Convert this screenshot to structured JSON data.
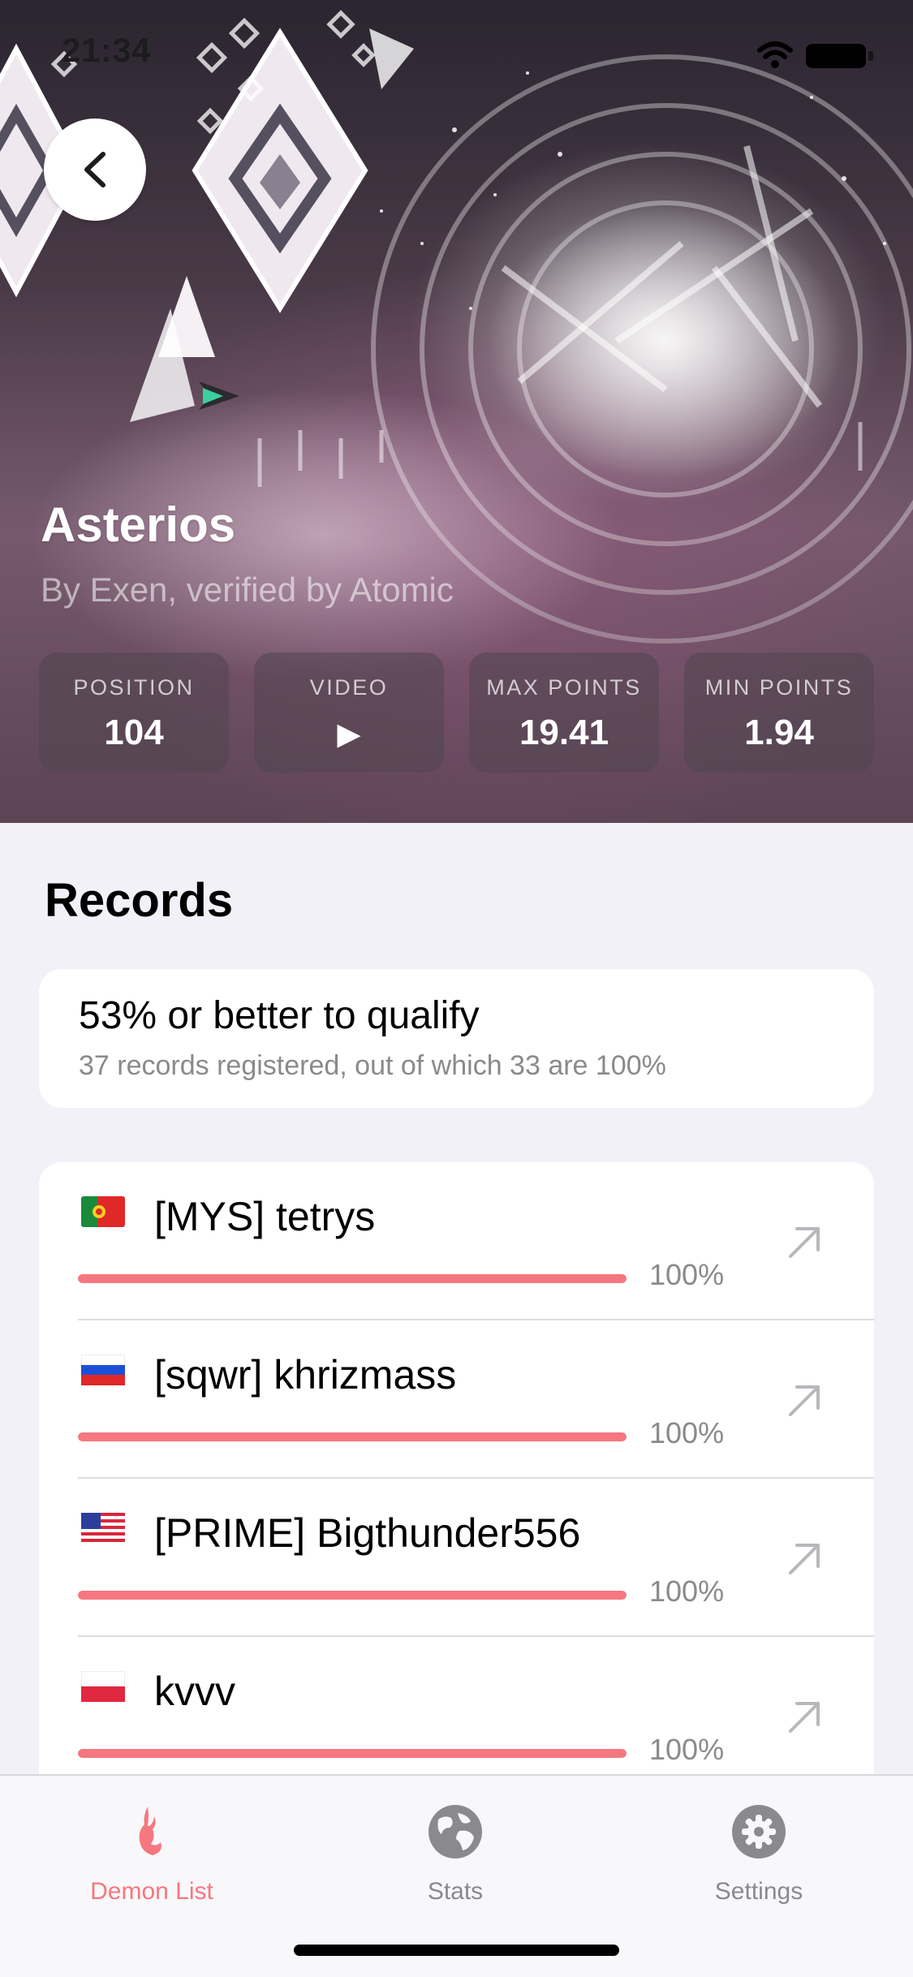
{
  "status_bar": {
    "time": "21:34"
  },
  "level": {
    "name": "Asterios",
    "subtitle": "By Exen, verified by Atomic",
    "stats": [
      {
        "label": "POSITION",
        "value": "104"
      },
      {
        "label": "VIDEO",
        "value": "▶"
      },
      {
        "label": "MAX POINTS",
        "value": "19.41"
      },
      {
        "label": "MIN POINTS",
        "value": "1.94"
      }
    ]
  },
  "records": {
    "heading": "Records",
    "qualify_text": "53% or better to qualify",
    "summary_text": "37 records registered, out of which 33 are 100%",
    "progress_color": "#f6777f",
    "items": [
      {
        "flag": "portugal",
        "name": "[MYS] tetrys",
        "progress": 100,
        "percent_label": "100%"
      },
      {
        "flag": "russia",
        "name": "[sqwr] khrizmass",
        "progress": 100,
        "percent_label": "100%"
      },
      {
        "flag": "united-states",
        "name": "[PRIME] Bigthunder556",
        "progress": 100,
        "percent_label": "100%"
      },
      {
        "flag": "poland",
        "name": "kvvv",
        "progress": 100,
        "percent_label": "100%"
      }
    ]
  },
  "tab_bar": {
    "active_color": "#f6777f",
    "inactive_color": "#8a8a8e",
    "tabs": [
      {
        "label": "Demon List",
        "icon": "demon-icon",
        "active": true
      },
      {
        "label": "Stats",
        "icon": "globe-icon",
        "active": false
      },
      {
        "label": "Settings",
        "icon": "gear-icon",
        "active": false
      }
    ]
  }
}
